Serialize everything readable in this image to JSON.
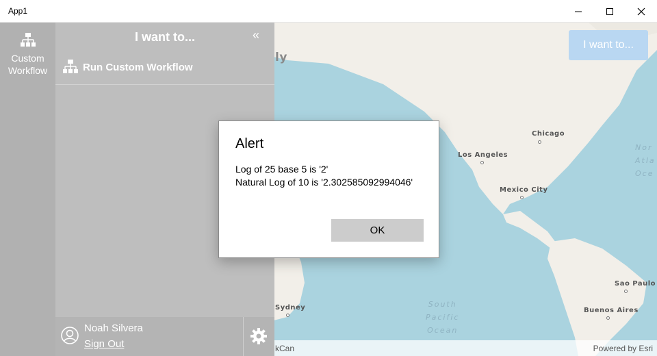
{
  "window": {
    "title": "App1"
  },
  "map": {
    "labels": {
      "chicago": "Chicago",
      "los_angeles": "Los Angeles",
      "mexico_city": "Mexico City",
      "sao_paulo": "Sao Paulo",
      "buenos_aires": "Buenos Aires",
      "sydney": "Sydney",
      "fragment_left": "ly"
    },
    "oceans": {
      "south_pacific": "South\nPacific\nOcean",
      "north_atlantic": "Nor\nAtla\nOce"
    },
    "credit": "Powered by Esri",
    "attribution_fragment": "kCan",
    "colors": {
      "water": "#aad3df",
      "land": "#f2efe9"
    }
  },
  "i_want_button": {
    "label": "I want to..."
  },
  "rail": {
    "item_label": "Custom\nWorkflow",
    "icon": "workflow-icon"
  },
  "panel": {
    "title": "I want to...",
    "collapse_glyph": "«",
    "workflow_label": "Run Custom Workflow",
    "user_name": "Noah Silvera",
    "sign_out_label": "Sign Out"
  },
  "dialog": {
    "title": "Alert",
    "line1": "Log of 25 base 5 is '2'",
    "line2": "Natural Log of 10 is '2.302585092994046'",
    "ok_label": "OK"
  }
}
